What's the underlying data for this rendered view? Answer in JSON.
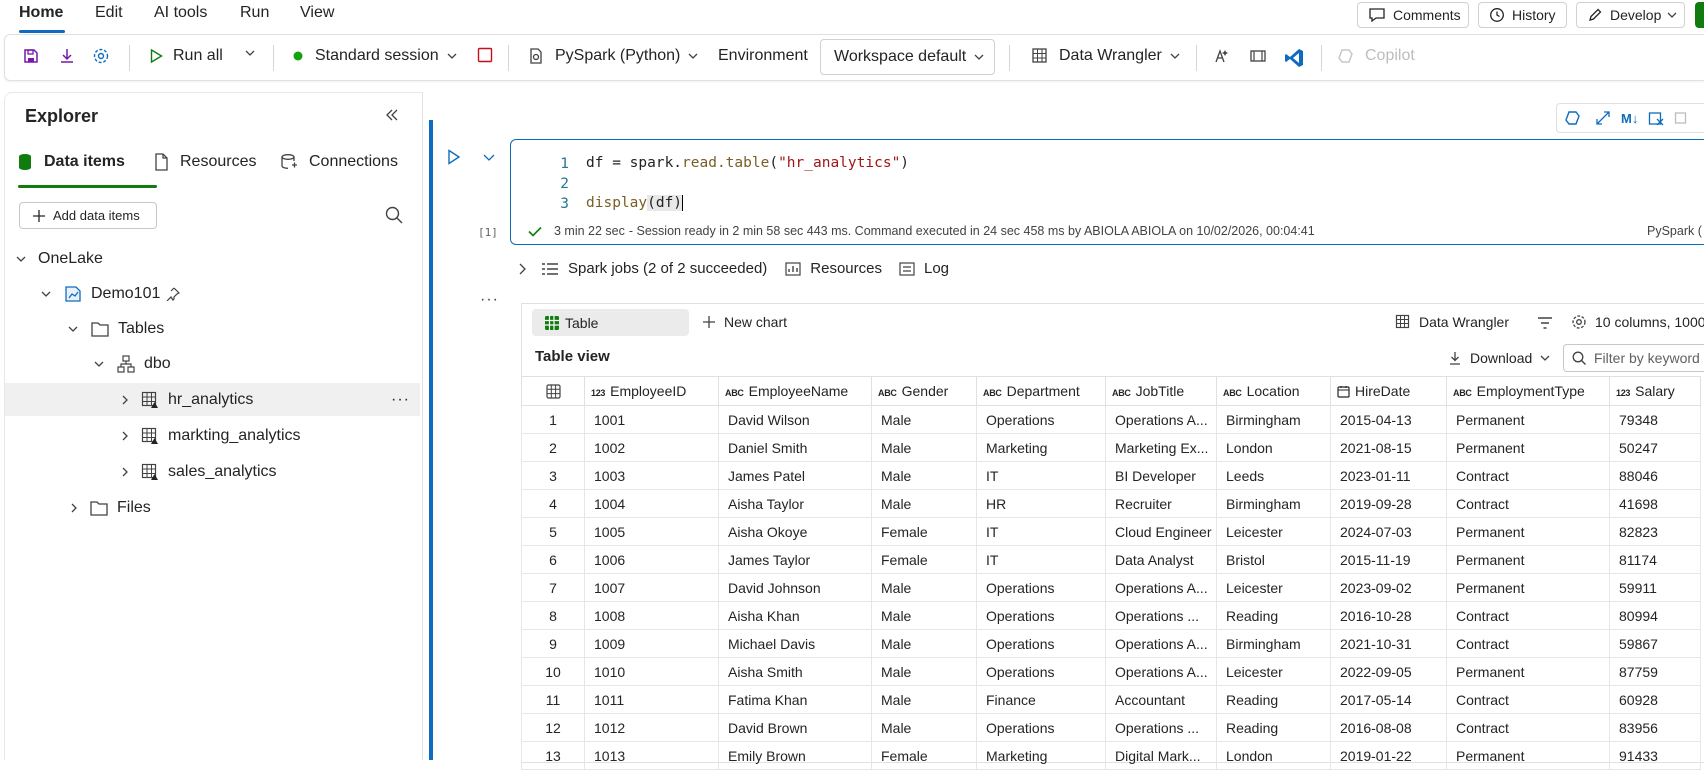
{
  "menu": {
    "items": [
      "Home",
      "Edit",
      "AI tools",
      "Run",
      "View"
    ],
    "active": "Home"
  },
  "top_buttons": {
    "comments": "Comments",
    "history": "History",
    "develop": "Develop"
  },
  "ribbon": {
    "run_all": "Run all",
    "session": "Standard session",
    "language": "PySpark (Python)",
    "environment_label": "Environment",
    "environment_value": "Workspace default",
    "data_wrangler": "Data Wrangler",
    "copilot": "Copilot"
  },
  "explorer": {
    "title": "Explorer",
    "tabs": {
      "data_items": "Data items",
      "resources": "Resources",
      "connections": "Connections"
    },
    "add_button": "Add data items",
    "tree": {
      "onelake": "OneLake",
      "lakehouse": "Demo101",
      "tables": "Tables",
      "schema": "dbo",
      "table_items": [
        "hr_analytics",
        "markting_analytics",
        "sales_analytics"
      ],
      "files": "Files"
    }
  },
  "cell": {
    "lines": [
      "1",
      "2",
      "3"
    ],
    "code_var": "df = spark.",
    "code_method": "read.table",
    "code_paren_open": "(",
    "code_string": "\"hr_analytics\"",
    "code_paren_close": ")",
    "code_line3_func": "display",
    "code_line3_arg": "(df)",
    "exec_count": "[1]",
    "status_time": "3 min 22 sec",
    "status_text": "- Session ready in 2 min 58 sec 443 ms. Command executed in 24 sec 458 ms by ABIOLA ABIOLA on 10/02/2026, 00:04:41",
    "status_lang": "PySpark (",
    "spark_jobs": "Spark jobs (2 of 2 succeeded)",
    "resources": "Resources",
    "log": "Log",
    "ellipsis": "···"
  },
  "output": {
    "tab_table": "Table",
    "new_chart": "New chart",
    "data_wrangler": "Data Wrangler",
    "columns_info": "10 columns, 1000",
    "table_view": "Table view",
    "download": "Download",
    "filter_placeholder": "Filter by keyword"
  },
  "table": {
    "columns": [
      {
        "type": "123",
        "name": "EmployeeID"
      },
      {
        "type": "ABC",
        "name": "EmployeeName"
      },
      {
        "type": "ABC",
        "name": "Gender"
      },
      {
        "type": "ABC",
        "name": "Department"
      },
      {
        "type": "ABC",
        "name": "JobTitle"
      },
      {
        "type": "ABC",
        "name": "Location"
      },
      {
        "type": "date",
        "name": "HireDate"
      },
      {
        "type": "ABC",
        "name": "EmploymentType"
      },
      {
        "type": "123",
        "name": "Salary"
      }
    ],
    "rows": [
      [
        "1",
        "1001",
        "David Wilson",
        "Male",
        "Operations",
        "Operations A...",
        "Birmingham",
        "2015-04-13",
        "Permanent",
        "79348"
      ],
      [
        "2",
        "1002",
        "Daniel Smith",
        "Male",
        "Marketing",
        "Marketing Ex...",
        "London",
        "2021-08-15",
        "Permanent",
        "50247"
      ],
      [
        "3",
        "1003",
        "James Patel",
        "Male",
        "IT",
        "BI Developer",
        "Leeds",
        "2023-01-11",
        "Contract",
        "88046"
      ],
      [
        "4",
        "1004",
        "Aisha Taylor",
        "Male",
        "HR",
        "Recruiter",
        "Birmingham",
        "2019-09-28",
        "Contract",
        "41698"
      ],
      [
        "5",
        "1005",
        "Aisha Okoye",
        "Female",
        "IT",
        "Cloud Engineer",
        "Leicester",
        "2024-07-03",
        "Permanent",
        "82823"
      ],
      [
        "6",
        "1006",
        "James Taylor",
        "Female",
        "IT",
        "Data Analyst",
        "Bristol",
        "2015-11-19",
        "Permanent",
        "81174"
      ],
      [
        "7",
        "1007",
        "David Johnson",
        "Male",
        "Operations",
        "Operations A...",
        "Leicester",
        "2023-09-02",
        "Permanent",
        "59911"
      ],
      [
        "8",
        "1008",
        "Aisha Khan",
        "Male",
        "Operations",
        "Operations ...",
        "Reading",
        "2016-10-28",
        "Contract",
        "80994"
      ],
      [
        "9",
        "1009",
        "Michael Davis",
        "Male",
        "Operations",
        "Operations A...",
        "Birmingham",
        "2021-10-31",
        "Contract",
        "59867"
      ],
      [
        "10",
        "1010",
        "Aisha Smith",
        "Male",
        "Operations",
        "Operations A...",
        "Leicester",
        "2022-09-05",
        "Permanent",
        "87759"
      ],
      [
        "11",
        "1011",
        "Fatima Khan",
        "Male",
        "Finance",
        "Accountant",
        "Reading",
        "2017-05-14",
        "Contract",
        "60928"
      ],
      [
        "12",
        "1012",
        "David Brown",
        "Male",
        "Operations",
        "Operations ...",
        "Reading",
        "2016-08-08",
        "Contract",
        "83956"
      ],
      [
        "13",
        "1013",
        "Emily Brown",
        "Female",
        "Marketing",
        "Digital Mark...",
        "London",
        "2019-01-22",
        "Permanent",
        "91433"
      ]
    ]
  },
  "colors": {
    "accent": "#0f6cbd",
    "success": "#107c10",
    "session_dot": "#13a10e",
    "stop": "#c50f1f",
    "save": "#7719aa"
  }
}
